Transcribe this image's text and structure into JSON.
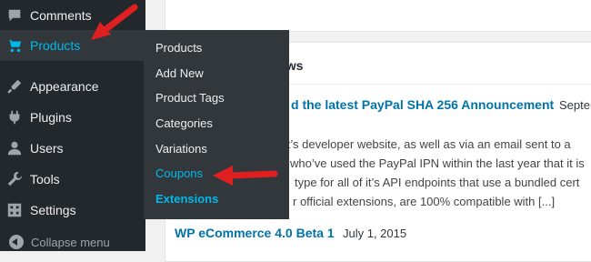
{
  "sidebar": {
    "items": [
      {
        "label": "Comments",
        "icon": "comment-icon"
      },
      {
        "label": "Products",
        "icon": "cart-icon",
        "active": true
      },
      {
        "label": "Appearance",
        "icon": "paintbrush-icon"
      },
      {
        "label": "Plugins",
        "icon": "plugin-icon"
      },
      {
        "label": "Users",
        "icon": "users-icon"
      },
      {
        "label": "Tools",
        "icon": "wrench-icon"
      },
      {
        "label": "Settings",
        "icon": "settings-icon"
      }
    ],
    "collapse_label": "Collapse menu"
  },
  "submenu": {
    "items": [
      {
        "label": "Products"
      },
      {
        "label": "Add New"
      },
      {
        "label": "Product Tags"
      },
      {
        "label": "Categories"
      },
      {
        "label": "Variations"
      },
      {
        "label": "Coupons",
        "highlight": true
      },
      {
        "label": "Extensions",
        "bold": true
      }
    ]
  },
  "news": {
    "header_fragment": "ews",
    "item1": {
      "title_fragment": "d the latest PayPal SHA 256 Announcement",
      "date_fragment": "Septer",
      "excerpt": [
        "n it’s developer website, as well as via an email sent to a",
        "who’ve used the PayPal IPN within the last year that it is",
        "type for all of it’s API endpoints that use a bundled cert",
        "r official extensions, are 100% compatible with [...]"
      ]
    },
    "item2": {
      "title": "WP eCommerce 4.0 Beta 1",
      "date": "July 1, 2015"
    }
  },
  "colors": {
    "sidebar_bg": "#23282d",
    "submenu_bg": "#32373c",
    "accent": "#00b9eb",
    "link": "#0073aa",
    "arrow": "#e02020"
  }
}
